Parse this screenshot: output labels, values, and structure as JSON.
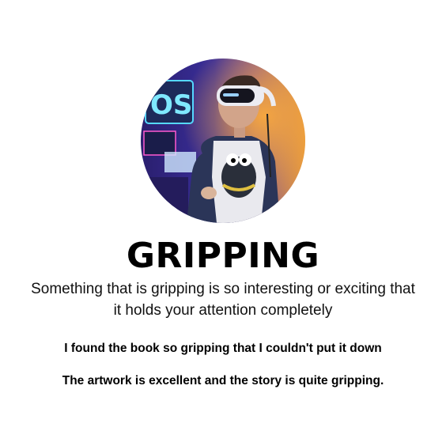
{
  "image": {
    "icon": "person-wearing-vr-headset-photo"
  },
  "word": "GRIPPING",
  "definition_line1": "Something that is gripping is so interesting or exciting that",
  "definition_line2": "it holds your attention completely",
  "examples": [
    "I found the book so gripping that I couldn't put it down",
    "The artwork is excellent and the story is quite gripping."
  ],
  "colors": {
    "background": "#ffffff",
    "text": "#000000"
  }
}
